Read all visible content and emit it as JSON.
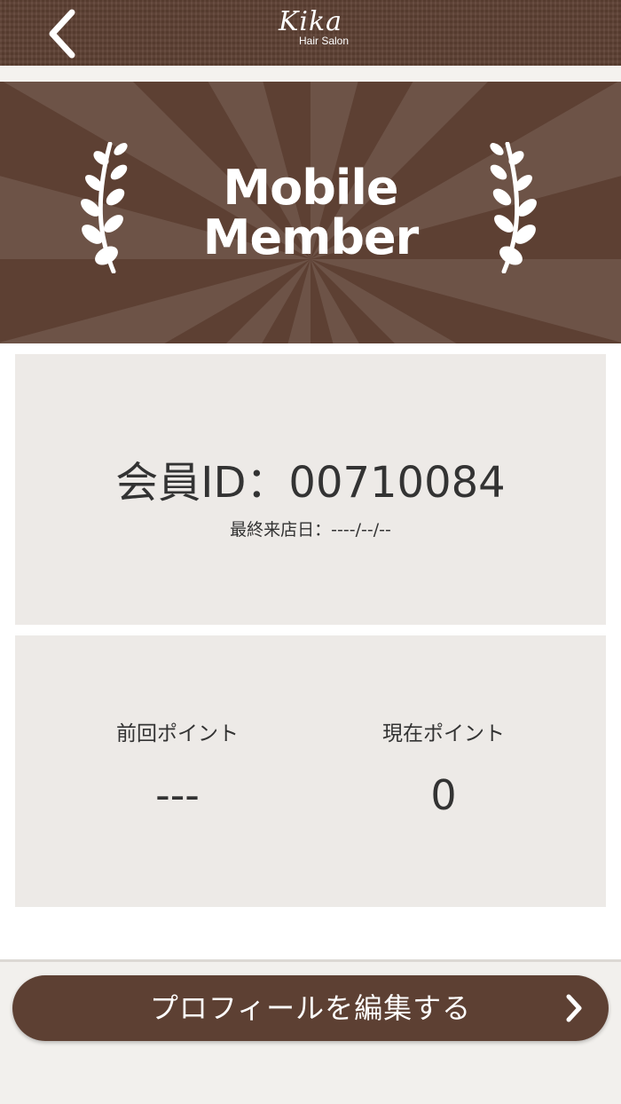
{
  "header": {
    "logo_main": "Kika",
    "logo_sub": "Hair Salon",
    "back_icon": "chevron-left-icon"
  },
  "banner": {
    "line1": "Mobile",
    "line2": "Member",
    "left_icon": "laurel-icon",
    "right_icon": "laurel-icon"
  },
  "member": {
    "id_text": "会員ID：00710084",
    "last_visit": "最終来店日：----/--/--"
  },
  "points": {
    "previous_label": "前回ポイント",
    "previous_value": "---",
    "current_label": "現在ポイント",
    "current_value": "0"
  },
  "footer": {
    "edit_profile_label": "プロフィールを編集する",
    "edit_icon": "chevron-right-icon"
  },
  "colors": {
    "brand_brown": "#5d4033",
    "card_bg": "#edeae7",
    "text": "#333333"
  }
}
